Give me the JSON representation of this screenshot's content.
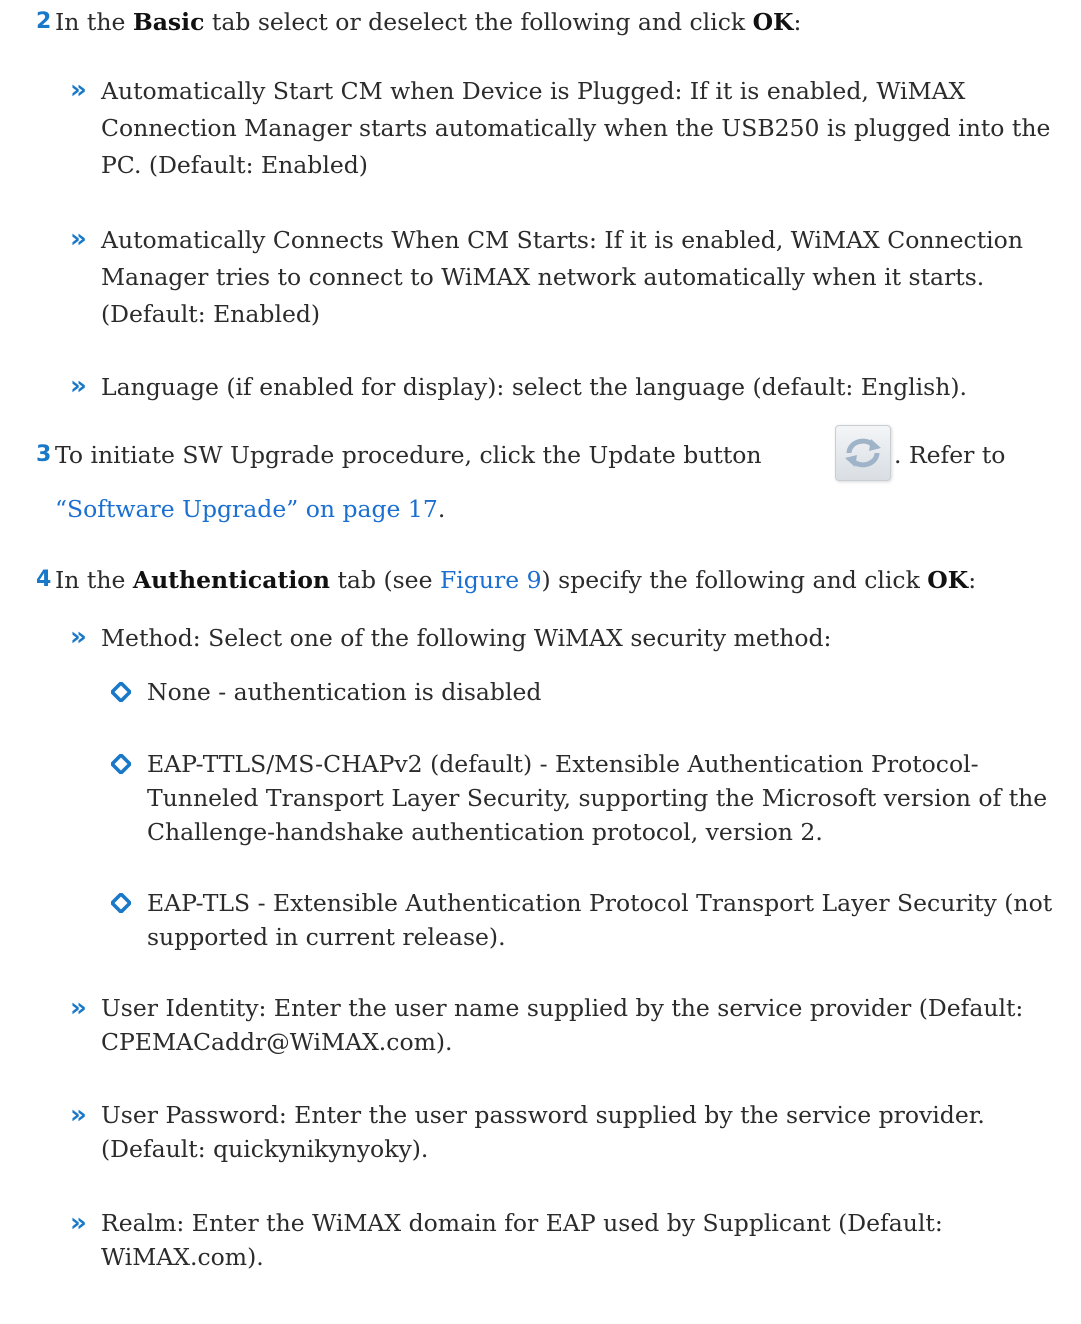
{
  "step2": {
    "number": "2",
    "pre": "In the ",
    "tab": "Basic",
    "mid": " tab select or deselect the following and click ",
    "ok": "OK",
    "end": ":",
    "bullets": [
      "Automatically Start CM when Device is Plugged: If it is enabled, WiMAX Connection Manager starts automatically when the USB250 is plugged into the PC. (Default: Enabled)",
      "Automatically Connects When CM Starts: If it is enabled, WiMAX Connection Manager tries to connect to WiMAX network automatically when it starts. (Default: Enabled)",
      "Language (if enabled for display): select the language (default: English)."
    ]
  },
  "step3": {
    "number": "3",
    "text": "To initiate SW Upgrade procedure, click the Update button",
    "after_icon": ". Refer to",
    "link": "“Software Upgrade” on page 17",
    "end": ".",
    "icon": "update-refresh-icon"
  },
  "step4": {
    "number": "4",
    "pre": "In the ",
    "tab": "Authentication",
    "mid1": " tab (see ",
    "figure_link": "Figure 9",
    "mid2": ") specify the following and click ",
    "ok": "OK",
    "end": ":",
    "method_bullet": "Method: Select one of the following WiMAX security method:",
    "methods": [
      "None - authentication is disabled",
      "EAP-TTLS/MS-CHAPv2 (default) - Extensible Authentication Protocol-Tunneled Transport Layer Security, supporting the Microsoft version of the Challenge-handshake authentication protocol, version 2.",
      "EAP-TLS - Extensible Authentication Protocol Transport Layer Security (not supported in current release)."
    ],
    "bullets": [
      "User Identity: Enter the user name supplied by the service provider (Default: CPEMACaddr@WiMAX.com).",
      "User Password: Enter the user password supplied by the service provider. (Default: quickynikynyoky).",
      "Realm: Enter the WiMAX domain for EAP used by Supplicant (Default: WiMAX.com)."
    ]
  },
  "colors": {
    "accent": "#1a78c8",
    "link": "#1a6fd0",
    "text": "#2b2b2b"
  },
  "bullet_glyph": "»"
}
